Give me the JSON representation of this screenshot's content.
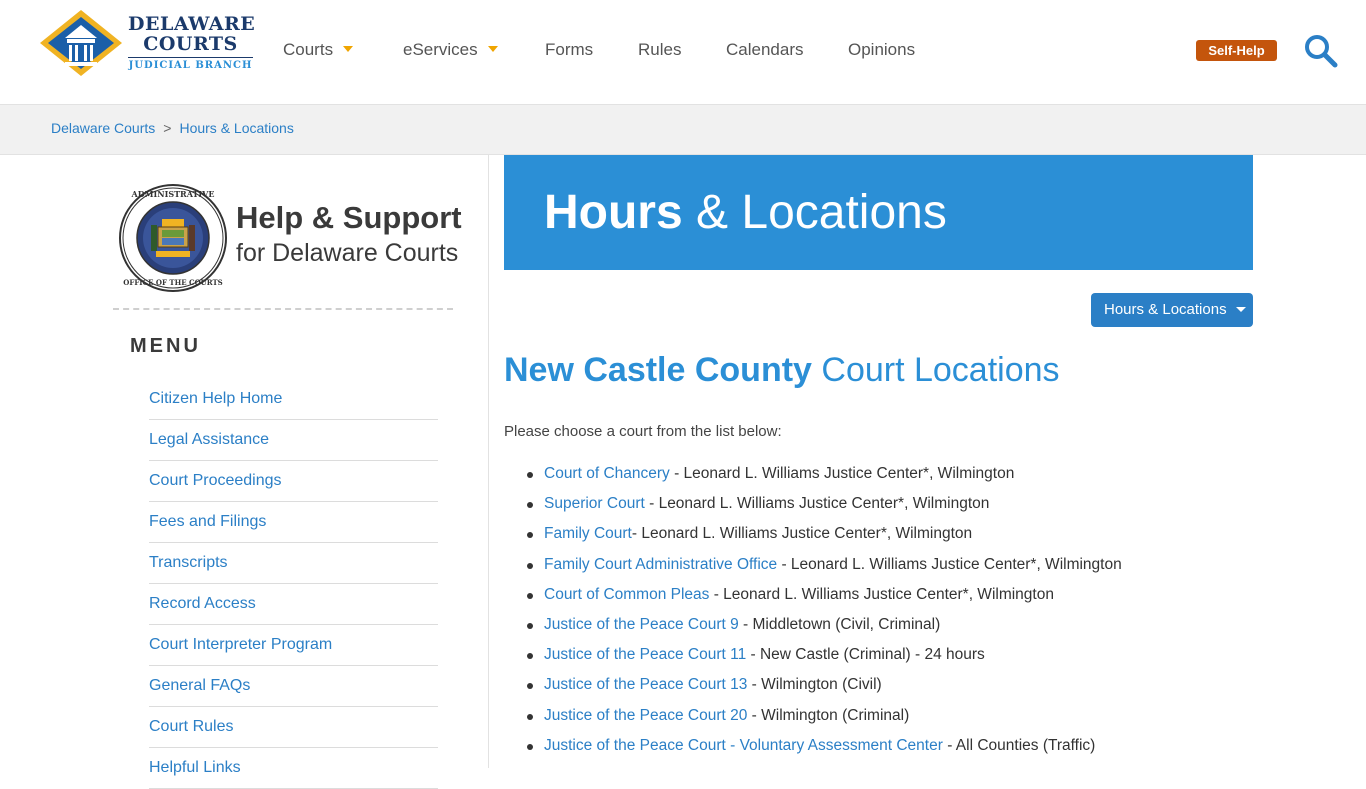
{
  "header": {
    "logo": {
      "line1": "DELAWARE",
      "line2": "COURTS",
      "line3": "JUDICIAL BRANCH"
    },
    "nav": [
      {
        "label": "Courts",
        "dropdown": true
      },
      {
        "label": "eServices",
        "dropdown": true
      },
      {
        "label": "Forms",
        "dropdown": false
      },
      {
        "label": "Rules",
        "dropdown": false
      },
      {
        "label": "Calendars",
        "dropdown": false
      },
      {
        "label": "Opinions",
        "dropdown": false
      }
    ],
    "self_help_label": "Self-Help",
    "search_icon": "search-icon"
  },
  "breadcrumb": {
    "home": "Delaware Courts",
    "separator": ">",
    "current": "Hours & Locations"
  },
  "sidebar": {
    "help_title": "Help & Support",
    "help_subtitle": "for Delaware Courts",
    "seal_text": "ADMINISTRATIVE OFFICE OF THE COURTS",
    "menu_label": "MENU",
    "menu_items": [
      "Citizen Help Home",
      "Legal Assistance",
      "Court Proceedings",
      "Fees and Filings",
      "Transcripts",
      "Record Access",
      "Court Interpreter Program",
      "General FAQs",
      "Court Rules",
      "Helpful Links"
    ]
  },
  "main": {
    "banner_bold": "Hours",
    "banner_rest": " & Locations",
    "dropdown_label": "Hours & Locations",
    "section_bold": "New Castle County",
    "section_rest": " Court Locations",
    "intro": "Please choose a court from the list below:",
    "courts": [
      {
        "link": "Court of Chancery",
        "desc": " - Leonard L. Williams Justice Center*, Wilmington"
      },
      {
        "link": "Superior Court",
        "desc": " - Leonard L. Williams Justice Center*, Wilmington"
      },
      {
        "link": "Family Court",
        "desc": "- Leonard L. Williams Justice Center*, Wilmington"
      },
      {
        "link": "Family Court Administrative Office",
        "desc": " - Leonard L. Williams Justice Center*, Wilmington"
      },
      {
        "link": "Court of Common Pleas",
        "desc": " - Leonard L. Williams Justice Center*, Wilmington"
      },
      {
        "link": "Justice of the Peace Court 9",
        "desc": " - Middletown (Civil, Criminal)"
      },
      {
        "link": "Justice of the Peace Court 11",
        "desc": " - New Castle (Criminal) - 24 hours"
      },
      {
        "link": "Justice of the Peace Court 13",
        "desc": " - Wilmington (Civil)"
      },
      {
        "link": "Justice of the Peace Court 20",
        "desc": " - Wilmington (Criminal)"
      },
      {
        "link": "Justice of the Peace Court - Voluntary Assessment Center",
        "desc": " - All Counties (Traffic)"
      }
    ]
  },
  "colors": {
    "primary_blue": "#2b8fd6",
    "link_blue": "#2b7fc6",
    "navy": "#1b3a6b",
    "accent_gold": "#f0a500",
    "self_help_orange": "#c4550c"
  }
}
